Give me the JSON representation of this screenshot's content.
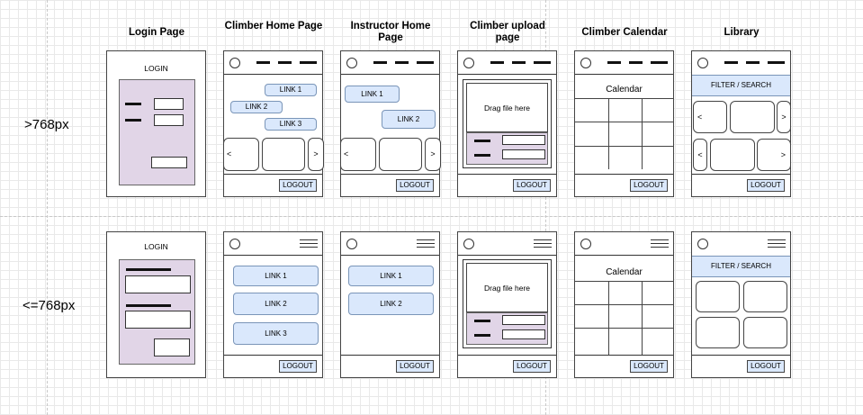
{
  "columns": {
    "login": "Login Page",
    "climber_home": "Climber Home Page",
    "instructor_home": "Instructor Home Page",
    "climber_upload": "Climber upload page",
    "climber_calendar": "Climber Calendar",
    "library": "Library"
  },
  "rows": {
    "wide": ">768px",
    "narrow": "<=768px"
  },
  "screens": {
    "login_heading": "LOGIN",
    "link1": "LINK 1",
    "link2": "LINK 2",
    "link3": "LINK 3",
    "logout": "LOGOUT",
    "drag_file": "Drag file here",
    "calendar": "Calendar",
    "filter_search": "FILTER / SEARCH",
    "arrow_left": "<",
    "arrow_right": ">"
  },
  "colors": {
    "link_fill": "#dae8fc",
    "form_fill": "#e1d5e7"
  }
}
